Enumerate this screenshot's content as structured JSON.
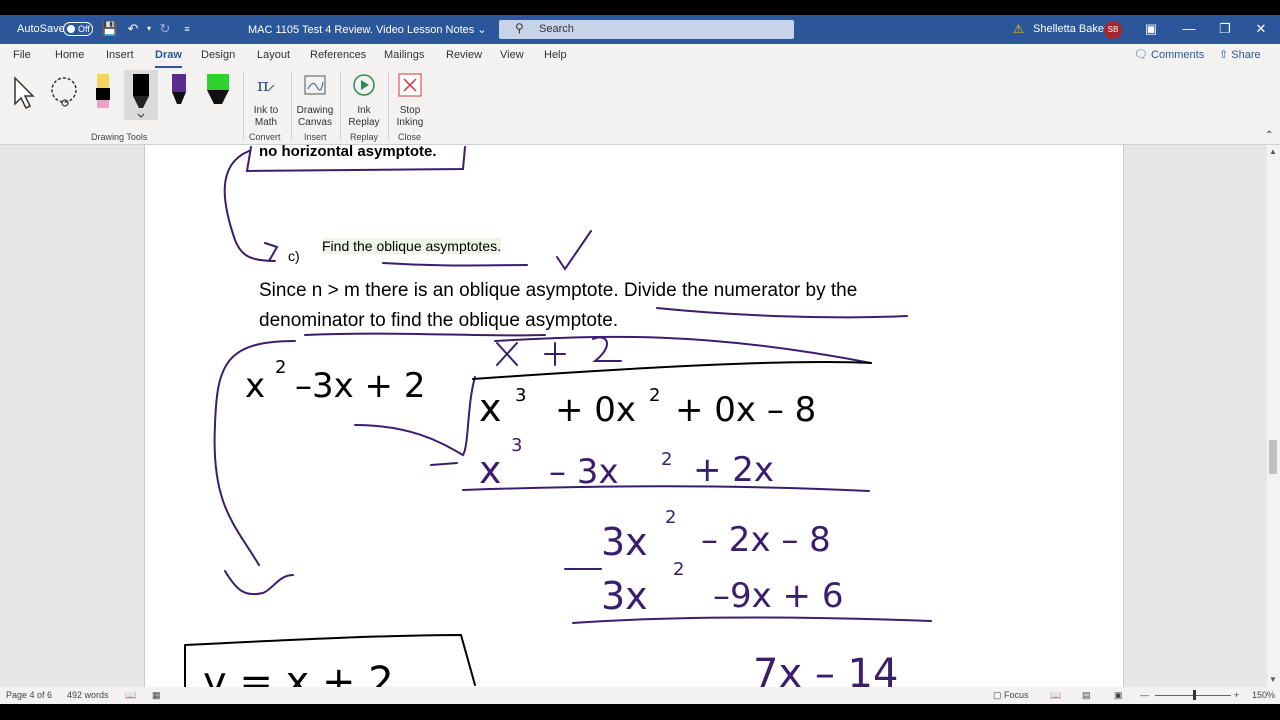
{
  "titlebar": {
    "autosave": "AutoSave",
    "toggle": "Off",
    "doc_title": "MAC 1105 Test 4 Review. Video Lesson Notes",
    "search_placeholder": "Search",
    "user": "Shelletta Baker",
    "initials": "SB"
  },
  "menu": {
    "items": [
      "File",
      "Home",
      "Insert",
      "Draw",
      "Design",
      "Layout",
      "References",
      "Mailings",
      "Review",
      "View",
      "Help"
    ],
    "active": "Draw",
    "comments": "Comments",
    "share": "Share"
  },
  "ribbon": {
    "drawing_tools": "Drawing Tools",
    "ink_to_math": "Ink to Math",
    "ink_to_math_line2": "Math",
    "ink_to_math_line1": "Ink to",
    "convert": "Convert",
    "drawing_canvas_line1": "Drawing",
    "drawing_canvas_line2": "Canvas",
    "insert": "Insert",
    "ink_replay_line1": "Ink",
    "ink_replay_line2": "Replay",
    "replay": "Replay",
    "stop_inking_line1": "Stop",
    "stop_inking_line2": "Inking",
    "close": "Close",
    "colors": {
      "accent": "#2b579a",
      "pen_yellow": "#f4d35e",
      "pen_black": "#000000",
      "pen_purple": "#5b2c8f",
      "pen_green": "#2fd12f"
    }
  },
  "document": {
    "boxed_text": "no horizontal asymptote.",
    "part_label": "c)",
    "prompt": "Find the oblique asymptotes.",
    "line1": "Since n > m there is an oblique asymptote. Divide the numerator by the",
    "line2": "denominator to find the oblique asymptote.",
    "ink_color": "#3b1d6e"
  },
  "status": {
    "page": "Page 4 of 6",
    "words": "492 words",
    "focus": "Focus",
    "zoom": "150%"
  }
}
